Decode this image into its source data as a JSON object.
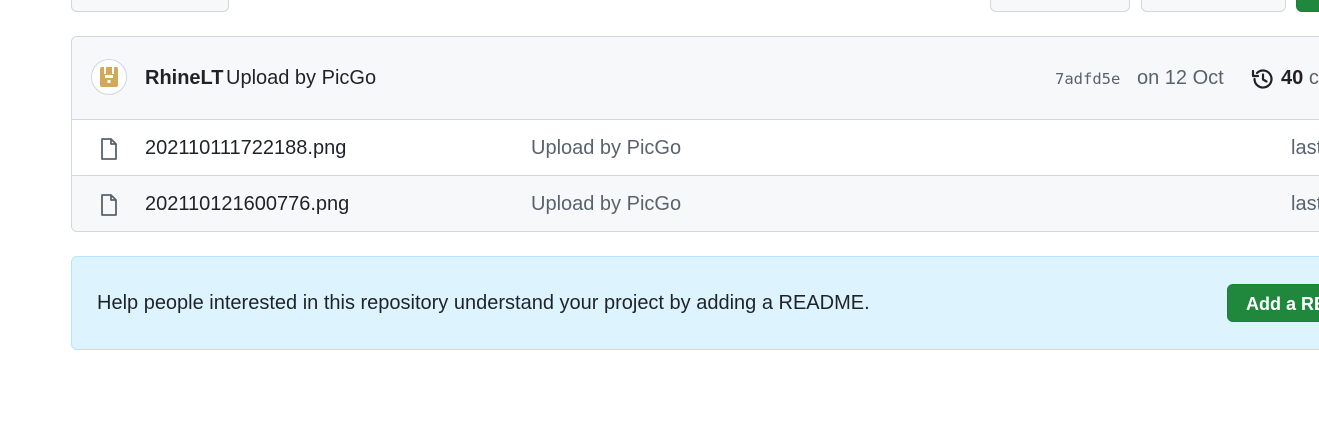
{
  "commit": {
    "author": "RhineLT",
    "message": "Upload by PicGo",
    "sha": "7adfd5e",
    "date": "on 12 Oct",
    "history_count": "40",
    "history_suffix": "c"
  },
  "files": [
    {
      "name": "202110111722188.png",
      "commit_message": "Upload by PicGo",
      "age": "last"
    },
    {
      "name": "202110121600776.png",
      "commit_message": "Upload by PicGo",
      "age": "last"
    }
  ],
  "readme": {
    "text": "Help people interested in this repository understand your project by adding a README.",
    "button_label": "Add a RE"
  },
  "icons": {
    "avatar": "avatar-image",
    "history": "history-icon",
    "file": "file-icon"
  },
  "colors": {
    "primary_button": "#1f883d",
    "readme_banner": "#ddf4ff",
    "border": "#d0d7de",
    "muted_text": "#59636e",
    "avatar_accent": "#d4a85a"
  }
}
